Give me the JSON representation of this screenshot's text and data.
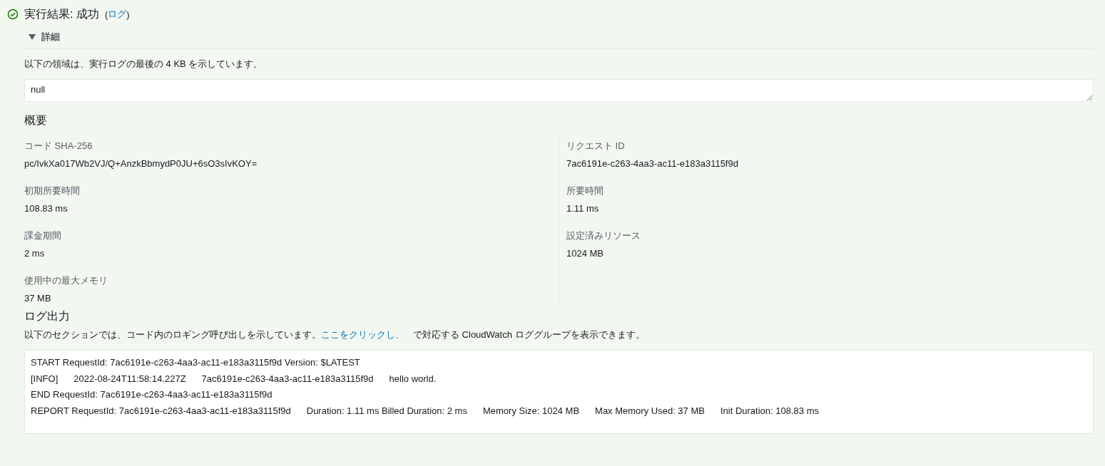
{
  "result": {
    "succeeded": true,
    "title": "実行結果: 成功",
    "open_paren": "(",
    "link": "ログ",
    "close_paren": ")"
  },
  "details": {
    "label": "詳細",
    "expanded": true,
    "description": "以下の領域は、実行ログの最後の 4 KB を示しています。",
    "value": "null"
  },
  "summary": {
    "title": "概要",
    "left": [
      {
        "label": "コード SHA-256",
        "value": "pc/IvkXa017Wb2VJ/Q+AnzkBbmydP0JU+6sO3sIvKOY="
      },
      {
        "label": "初期所要時間",
        "value": "108.83 ms"
      },
      {
        "label": "課金期間",
        "value": "2 ms"
      },
      {
        "label": "使用中の最大メモリ",
        "value": "37 MB"
      }
    ],
    "right": [
      {
        "label": "リクエスト ID",
        "value": "7ac6191e-c263-4aa3-ac11-e183a3115f9d"
      },
      {
        "label": "所要時間",
        "value": "1.11 ms"
      },
      {
        "label": "設定済みリソース",
        "value": "1024 MB"
      }
    ]
  },
  "log_output": {
    "title": "ログ出力",
    "description_before": "以下のセクションでは、コード内のロギング呼び出しを示しています。",
    "link": "ここをクリックし、",
    "description_after": "で対応する CloudWatch ロググループを表示できます。",
    "lines": [
      [
        "START RequestId: 7ac6191e-c263-4aa3-ac11-e183a3115f9d Version: $LATEST"
      ],
      [
        "[INFO]",
        "2022-08-24T11:58:14.227Z",
        "7ac6191e-c263-4aa3-ac11-e183a3115f9d",
        "hello world."
      ],
      [
        "END RequestId: 7ac6191e-c263-4aa3-ac11-e183a3115f9d"
      ],
      [
        "REPORT RequestId: 7ac6191e-c263-4aa3-ac11-e183a3115f9d",
        "Duration: 1.11 ms Billed Duration: 2 ms",
        "Memory Size: 1024 MB",
        "Max Memory Used: 37 MB",
        "Init Duration: 108.83 ms"
      ]
    ]
  }
}
